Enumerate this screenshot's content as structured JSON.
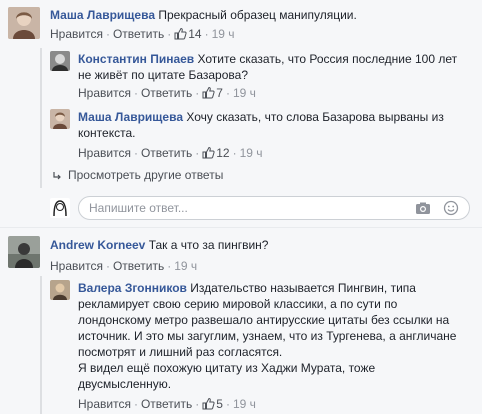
{
  "comments": [
    {
      "author": "Маша Лаврищева",
      "text": "Прекрасный образец манипуляции.",
      "like": "Нравится",
      "reply": "Ответить",
      "likes": "14",
      "time": "19 ч"
    },
    {
      "author": "Константин Пинаев",
      "text_line1": "Хотите сказать, что Россия последние 100 лет",
      "text_line2": "не живёт по цитате Базарова?",
      "like": "Нравится",
      "reply": "Ответить",
      "likes": "7",
      "time": "19 ч"
    },
    {
      "author": "Маша Лаврищева",
      "text_line1": "Хочу сказать, что слова Базарова вырваны из",
      "text_line2": "контекста.",
      "like": "Нравится",
      "reply": "Ответить",
      "likes": "12",
      "time": "19 ч"
    },
    {
      "author": "Andrew Korneev",
      "text": "Так а что за пингвин?",
      "like": "Нравится",
      "reply": "Ответить",
      "time": "19 ч"
    },
    {
      "author": "Валера Згонников",
      "text_line1": "Издательство называется Пингвин, типа",
      "text_line2": "рекламирует свою серию мировой классики, а по сути по",
      "text_line3": "лондонскому метро развешало антирусские цитаты без ссылки на",
      "text_line4": "источник. И это мы загуглим, узнаем, что из Тургенева, а англичане",
      "text_line5": "посмотрят и лишний раз согласятся.",
      "text_line6": "Я видел ещё похожую цитату из Хаджи Мурата, тоже",
      "text_line7": "двусмысленную.",
      "like": "Нравится",
      "reply": "Ответить",
      "likes": "5",
      "time": "19 ч"
    }
  ],
  "more_replies": "Просмотреть другие ответы",
  "composer": {
    "placeholder": "Напишите ответ..."
  },
  "icons": {
    "like": "thumbs-up-icon",
    "reply_arrow": "reply-arrow-icon",
    "camera": "camera-icon",
    "emoji": "smiley-icon"
  },
  "colors": {
    "link": "#365899",
    "meta": "#90949c",
    "background": "#f6f7f9"
  }
}
